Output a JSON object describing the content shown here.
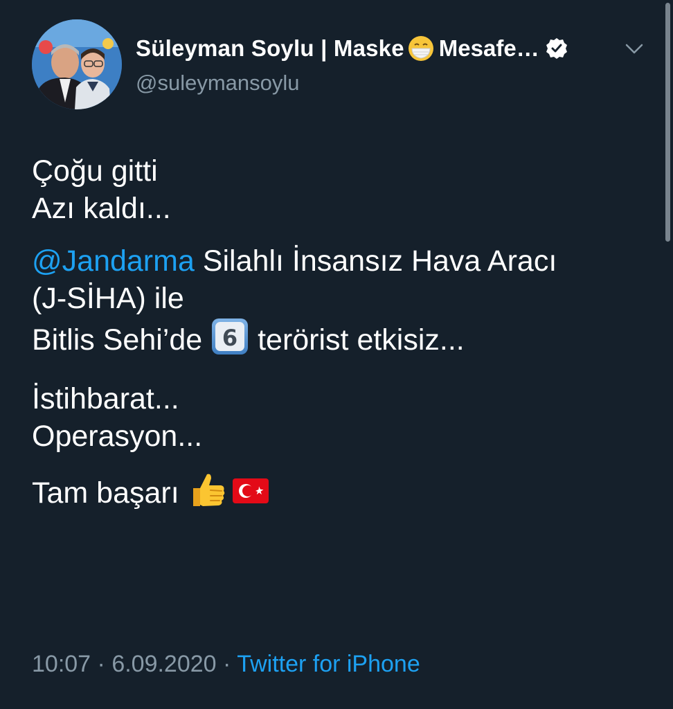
{
  "tweet": {
    "author": {
      "name_part1": "Süleyman Soylu | Maske",
      "name_emoji": "face-with-medical-mask-icon",
      "name_part2": "Mesafe…",
      "verified": true,
      "handle": "@suleymansoylu"
    },
    "body": {
      "p1_line1": "Çoğu gitti",
      "p1_line2": "Azı kaldı...",
      "p2_mention": "@Jandarma",
      "p2_line1_rest": " Silahlı İnsansız Hava Aracı",
      "p2_line2": "(J-SİHA) ile",
      "p2_line3_before": "Bitlis Sehi’de ",
      "p2_line3_emoji": "6",
      "p2_line3_after": " terörist etkisiz...",
      "p3_line1": "İstihbarat...",
      "p3_line2": "Operasyon...",
      "p4_text": "Tam başarı "
    },
    "emojis": {
      "thumbs": "thumbs-up-icon",
      "flag": "turkey-flag-icon",
      "keycap": "keycap-6-icon"
    },
    "meta": {
      "time": "10:07",
      "separator": " · ",
      "date": "6.09.2020",
      "source": "Twitter for iPhone"
    }
  },
  "colors": {
    "background": "#15202b",
    "accent": "#1da1f2",
    "secondary_text": "#8899a6"
  }
}
